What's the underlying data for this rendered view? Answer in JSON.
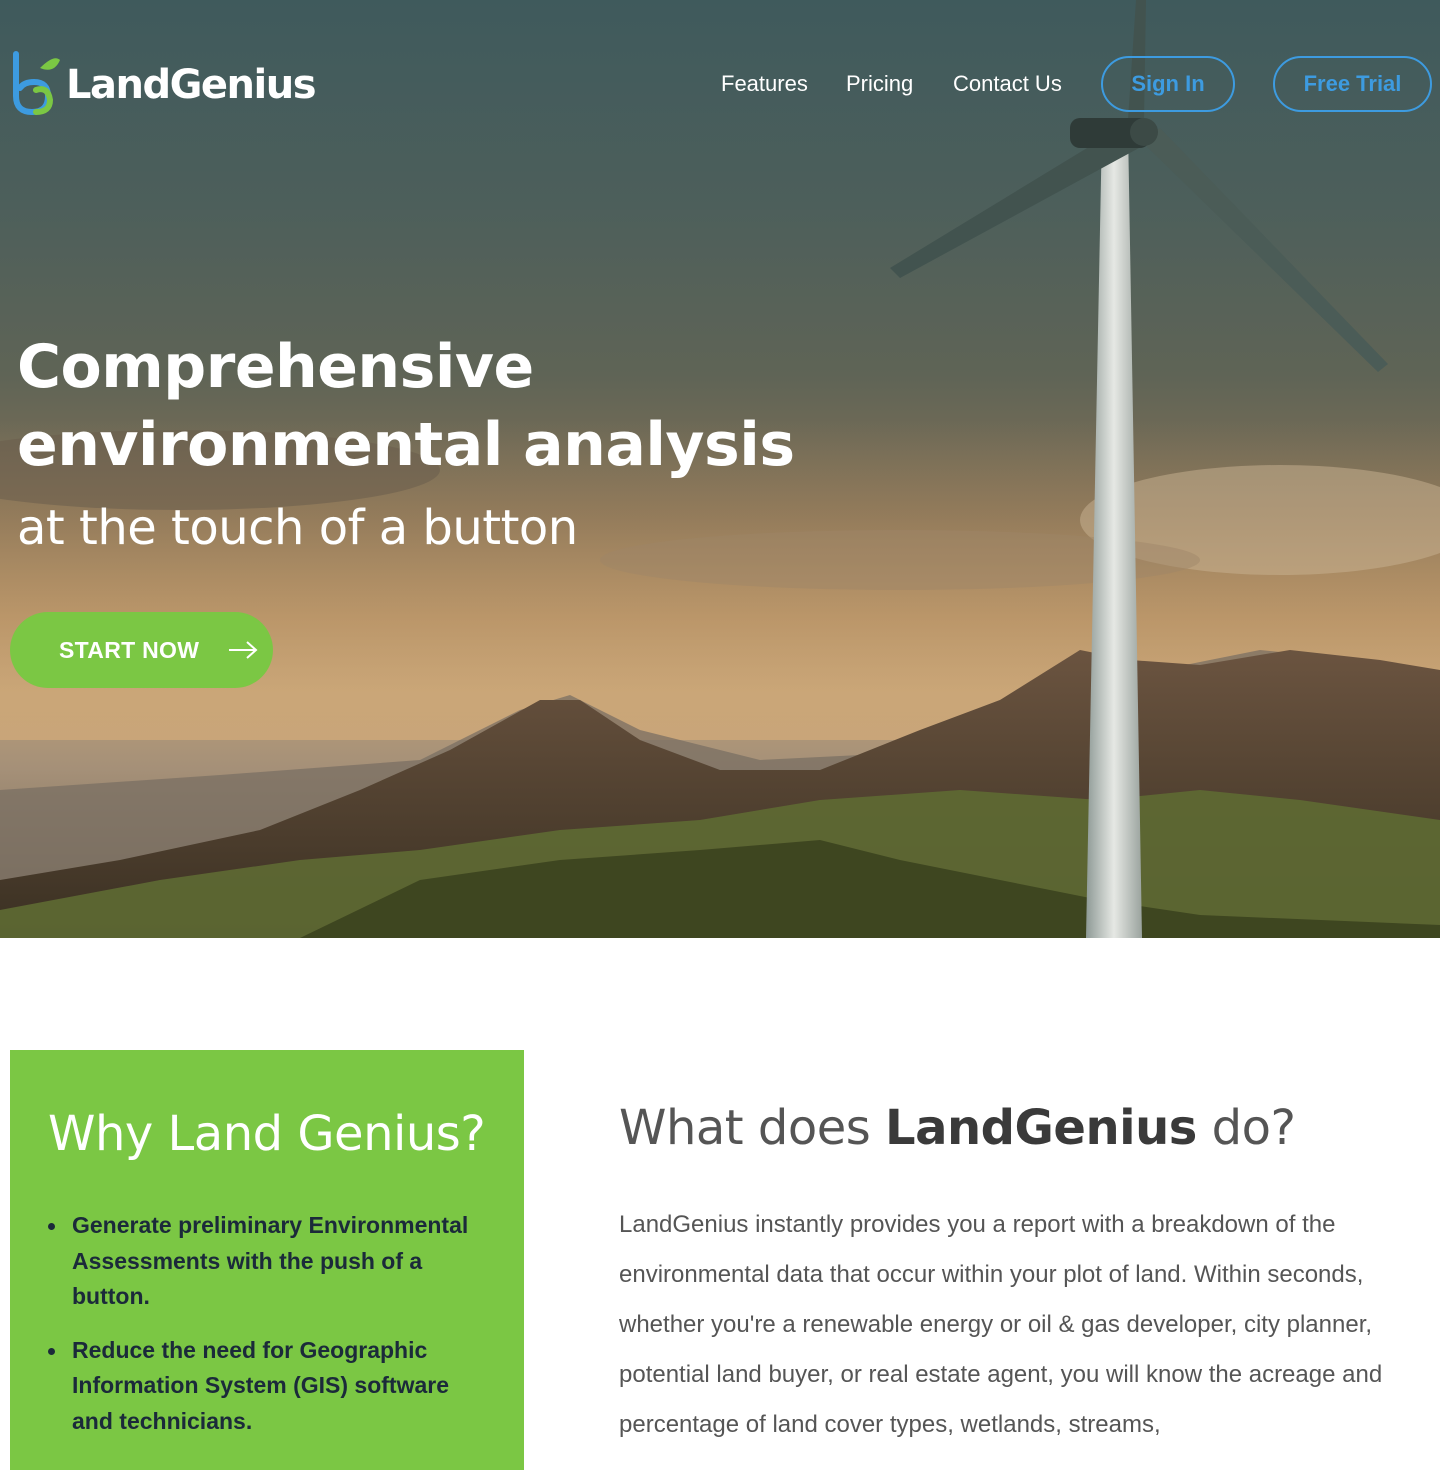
{
  "brand": {
    "name": "LandGenius",
    "logo_icon": "leaf-g-logo-icon",
    "colors": {
      "green": "#7bc744",
      "blue": "#3d9be0",
      "dark_text": "#1b2a3a",
      "body_text": "#555555"
    }
  },
  "nav": {
    "links": [
      {
        "label": "Features"
      },
      {
        "label": "Pricing"
      },
      {
        "label": "Contact Us"
      }
    ],
    "sign_in_label": "Sign In",
    "free_trial_label": "Free Trial"
  },
  "hero": {
    "title_line1": "Comprehensive",
    "title_line2": "environmental analysis",
    "subtitle": "at the touch of a button",
    "cta_label": "START NOW",
    "cta_icon": "arrow-right-icon"
  },
  "why": {
    "title": "Why Land Genius?",
    "items": [
      {
        "text": "Generate preliminary Environmental Assessments with the push of a button."
      },
      {
        "text": "Reduce the need for Geographic Information System (GIS) software and technicians."
      }
    ]
  },
  "what": {
    "title_prefix": "What does ",
    "title_brand": "LandGenius",
    "title_suffix": " do?",
    "body": "LandGenius instantly provides you a report with a breakdown of the environmental data that occur within your plot of land. Within seconds, whether you're a renewable energy or oil & gas developer, city planner, potential land buyer, or real estate agent, you will know the acreage and percentage of land cover types, wetlands, streams,"
  }
}
